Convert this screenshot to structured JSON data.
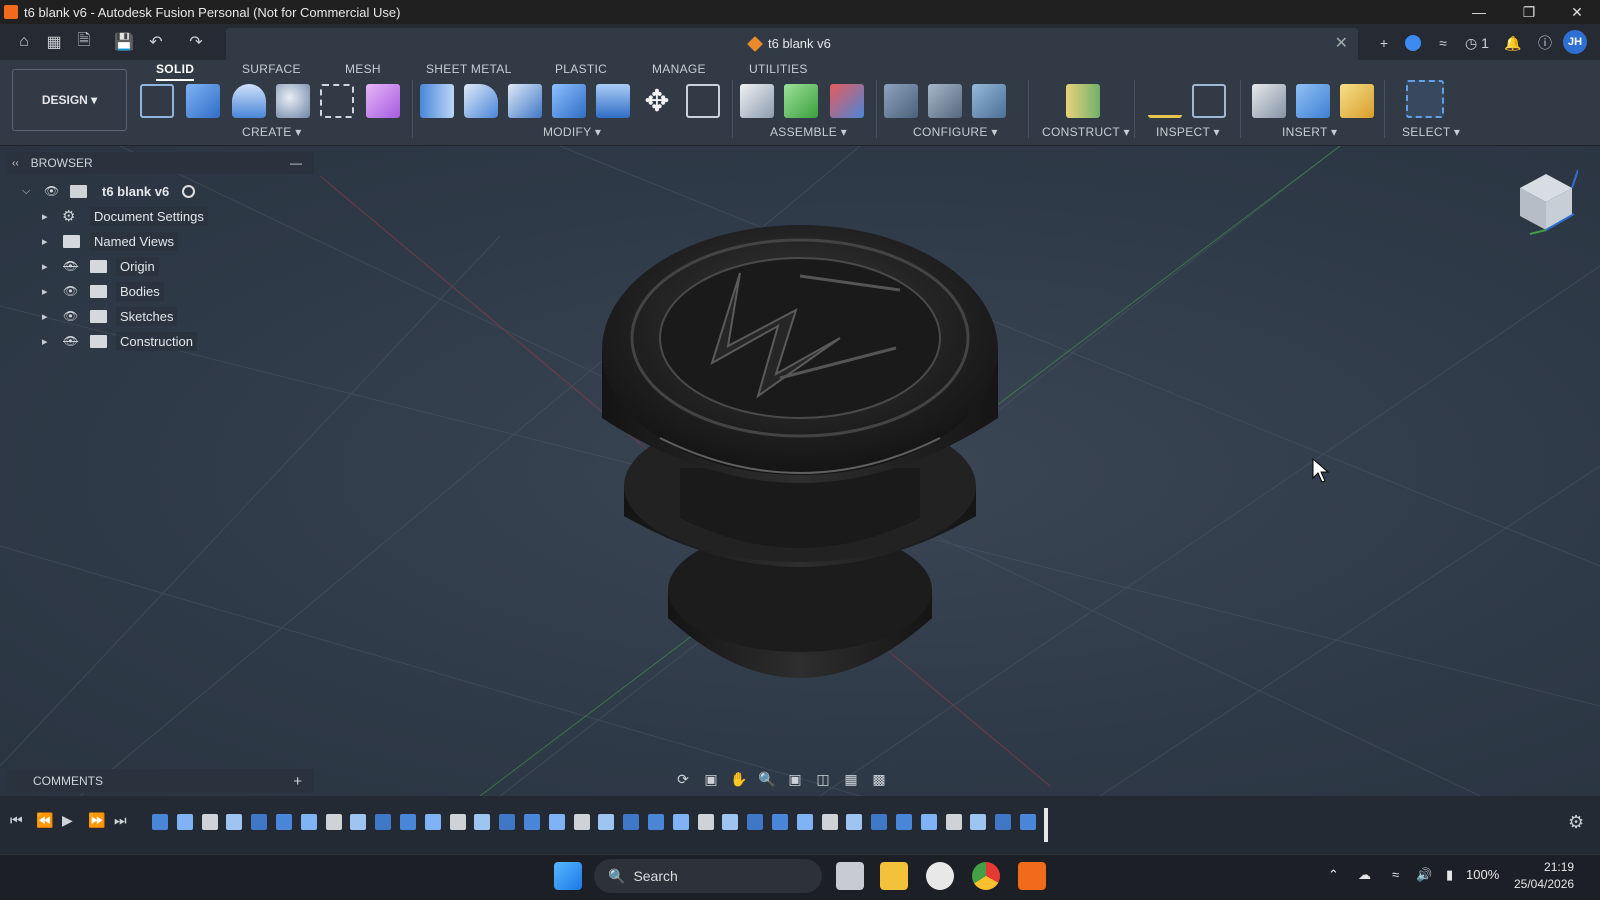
{
  "window": {
    "title": "t6 blank v6 - Autodesk Fusion Personal (Not for Commercial Use)",
    "minimize_icon": "minimize-icon",
    "maximize_icon": "restore-icon",
    "close_icon": "close-icon"
  },
  "doc_tab": {
    "label": "t6 blank v6"
  },
  "quick_access": {
    "user_initials": "JH",
    "jobs_count": "1"
  },
  "workspace": {
    "label": "DESIGN"
  },
  "tabs": [
    "SOLID",
    "SURFACE",
    "MESH",
    "SHEET METAL",
    "PLASTIC",
    "MANAGE",
    "UTILITIES"
  ],
  "groups": [
    "CREATE",
    "MODIFY",
    "ASSEMBLE",
    "CONFIGURE",
    "CONSTRUCT",
    "INSPECT",
    "INSERT",
    "SELECT"
  ],
  "browser": {
    "header": "BROWSER",
    "root": "t6 blank v6",
    "items": [
      "Document Settings",
      "Named Views",
      "Origin",
      "Bodies",
      "Sketches",
      "Construction"
    ]
  },
  "comments": {
    "label": "COMMENTS"
  },
  "taskbar": {
    "search": "Search",
    "battery": "100%",
    "time": "21:19",
    "date": "25/04/2026"
  },
  "colors": {
    "accent": "#f26a1b",
    "viewport_bg": "#2f3a48",
    "toolbar_bg": "#323a46"
  }
}
